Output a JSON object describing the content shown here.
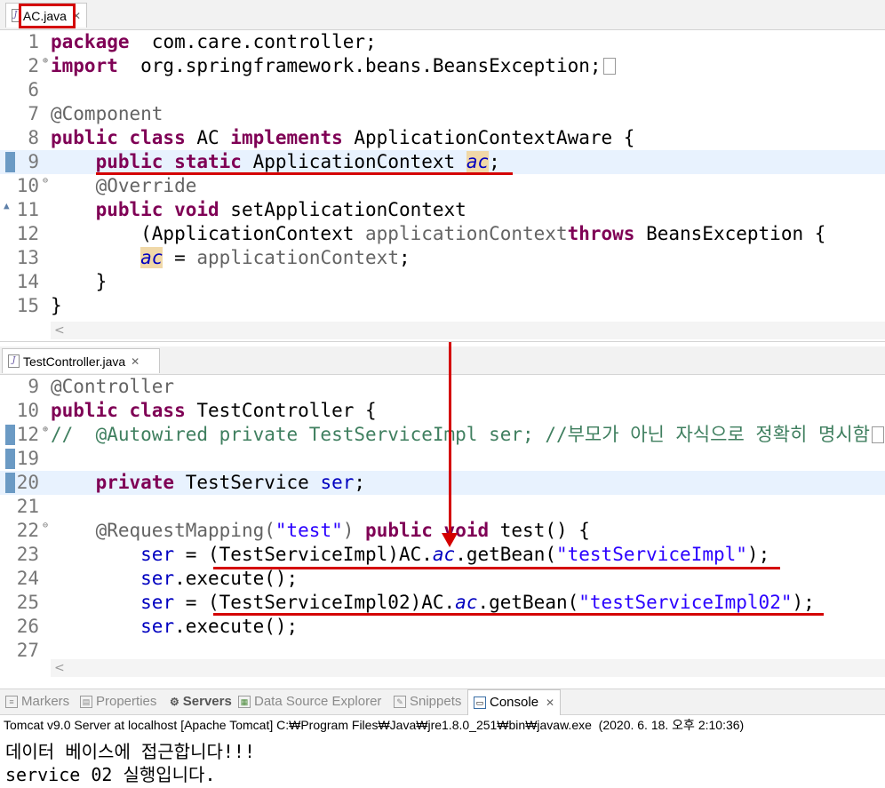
{
  "editor1": {
    "tab": "AC.java",
    "lines": [
      {
        "n": "1",
        "t": [
          [
            "kw",
            "package"
          ],
          [
            "",
            "  com.care.controller;"
          ]
        ]
      },
      {
        "n": "2",
        "fold": "⊕",
        "t": [
          [
            "kw",
            "import"
          ],
          [
            "",
            "  org.springframework.beans.BeansException;"
          ]
        ],
        "box": true
      },
      {
        "n": "6",
        "t": []
      },
      {
        "n": "7",
        "t": [
          [
            "ann",
            "@Component"
          ]
        ]
      },
      {
        "n": "8",
        "t": [
          [
            "kw",
            "public class"
          ],
          [
            "",
            " AC "
          ],
          [
            "kw",
            "implements"
          ],
          [
            "",
            " ApplicationContextAware {"
          ]
        ]
      },
      {
        "n": "9",
        "mark": true,
        "cur": true,
        "t": [
          [
            "",
            "    "
          ],
          [
            "kw",
            "public static"
          ],
          [
            "",
            " ApplicationContext "
          ],
          [
            "sfld occ",
            "ac"
          ],
          [
            "",
            ";"
          ]
        ]
      },
      {
        "n": "10",
        "fold": "⊖",
        "t": [
          [
            "",
            "    "
          ],
          [
            "ann",
            "@Override"
          ]
        ]
      },
      {
        "n": "11",
        "ovr": true,
        "t": [
          [
            "",
            "    "
          ],
          [
            "kw",
            "public void"
          ],
          [
            "",
            " setApplicationContext"
          ]
        ]
      },
      {
        "n": "12",
        "t": [
          [
            "",
            "        (ApplicationContext "
          ],
          [
            "ann",
            "applicationContext"
          ],
          [
            ") "
          ],
          [
            "kw",
            "throws"
          ],
          [
            "",
            " BeansException {"
          ]
        ]
      },
      {
        "n": "13",
        "t": [
          [
            "",
            "        "
          ],
          [
            "sfld occ",
            "ac"
          ],
          [
            "",
            " = "
          ],
          [
            "ann",
            "applicationContext"
          ],
          [
            "",
            ";"
          ]
        ]
      },
      {
        "n": "14",
        "t": [
          [
            "",
            "    }"
          ]
        ]
      },
      {
        "n": "15",
        "t": [
          [
            "",
            "}"
          ]
        ]
      }
    ]
  },
  "editor2": {
    "tab": "TestController.java",
    "lines": [
      {
        "n": "9",
        "t": [
          [
            "ann",
            "@Controller"
          ]
        ]
      },
      {
        "n": "10",
        "t": [
          [
            "kw",
            "public class"
          ],
          [
            "",
            " TestController {"
          ]
        ]
      },
      {
        "n": "12",
        "mark": true,
        "fold": "⊕",
        "t": [
          [
            "cmt",
            "//  @Autowired private TestServiceImpl "
          ],
          [
            "cmt",
            "ser"
          ],
          [
            "cmt",
            "; //부모가 아닌 자식으로 정확히 명시함"
          ]
        ],
        "box": true
      },
      {
        "n": "19",
        "mark": true,
        "t": []
      },
      {
        "n": "20",
        "mark": true,
        "cur": true,
        "t": [
          [
            "",
            "    "
          ],
          [
            "kw",
            "private"
          ],
          [
            "",
            " TestService "
          ],
          [
            "fld",
            "ser"
          ],
          [
            "",
            ";"
          ]
        ]
      },
      {
        "n": "21",
        "t": []
      },
      {
        "n": "22",
        "fold": "⊖",
        "t": [
          [
            "",
            "    "
          ],
          [
            "ann",
            "@RequestMapping("
          ],
          [
            "str",
            "\"test\""
          ],
          [
            "ann",
            ")"
          ],
          [
            "",
            " "
          ],
          [
            "kw",
            "public void"
          ],
          [
            "",
            " test() {"
          ]
        ]
      },
      {
        "n": "23",
        "t": [
          [
            "",
            "        "
          ],
          [
            "fld",
            "ser"
          ],
          [
            "",
            " = (TestServiceImpl)AC."
          ],
          [
            "sfld",
            "ac"
          ],
          [
            "",
            ".getBean("
          ],
          [
            "str",
            "\"testServiceImpl\""
          ],
          [
            "",
            ");"
          ]
        ]
      },
      {
        "n": "24",
        "t": [
          [
            "",
            "        "
          ],
          [
            "fld",
            "ser"
          ],
          [
            "",
            ".execute();"
          ]
        ]
      },
      {
        "n": "25",
        "t": [
          [
            "",
            "        "
          ],
          [
            "fld",
            "ser"
          ],
          [
            "",
            " = (TestServiceImpl02)AC."
          ],
          [
            "sfld",
            "ac"
          ],
          [
            "",
            ".getBean("
          ],
          [
            "str",
            "\"testServiceImpl02\""
          ],
          [
            "",
            ");"
          ]
        ]
      },
      {
        "n": "26",
        "t": [
          [
            "",
            "        "
          ],
          [
            "fld",
            "ser"
          ],
          [
            "",
            ".execute();"
          ]
        ]
      },
      {
        "n": "27",
        "t": []
      }
    ]
  },
  "console": {
    "tabs": [
      "Markers",
      "Properties",
      "Servers",
      "Data Source Explorer",
      "Snippets",
      "Console"
    ],
    "header": "Tomcat v9.0 Server at localhost [Apache Tomcat] C:₩Program Files₩Java₩jre1.8.0_251₩bin₩javaw.exe  (2020. 6. 18. 오후 2:10:36)",
    "output": [
      "데이터 베이스에 접근합니다!!!",
      "service 02 실행입니다."
    ]
  },
  "colors": {
    "keyword": "#7f0055",
    "annotation": "#646464",
    "string": "#2a00ff",
    "field": "#0000c0",
    "comment": "#3f7f5f",
    "highlight": "#d40000"
  }
}
